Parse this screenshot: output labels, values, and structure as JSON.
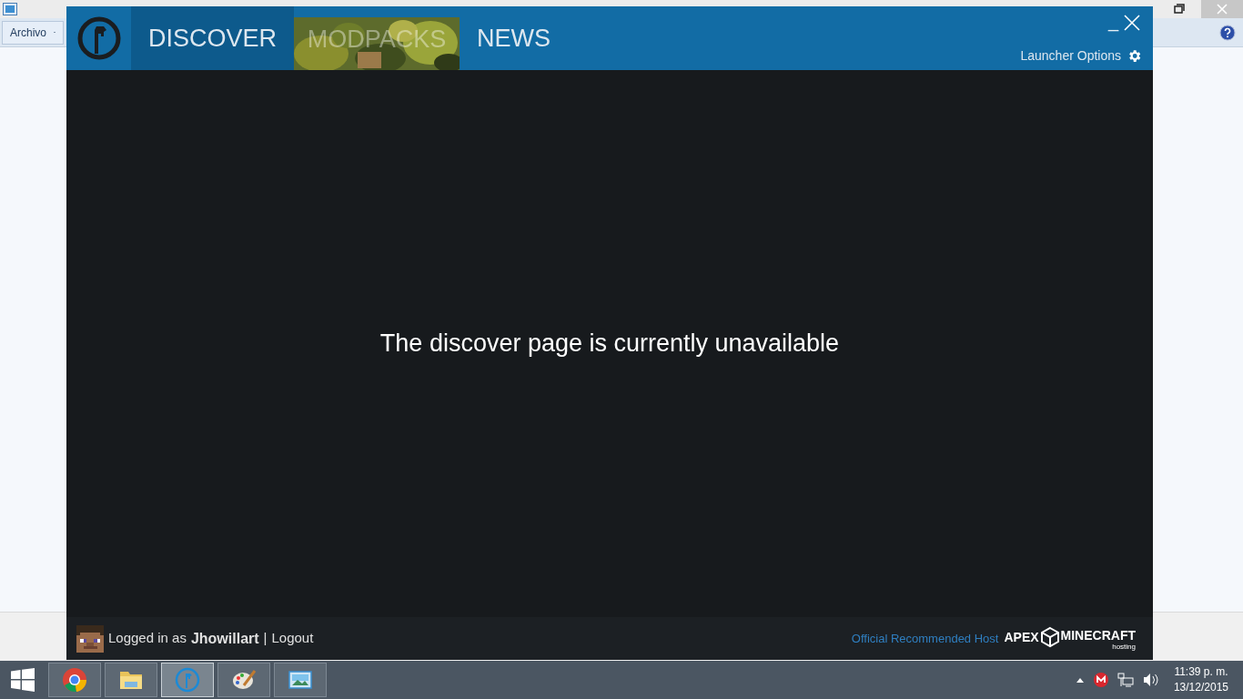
{
  "background_window": {
    "menu_button": "Archivo"
  },
  "launcher": {
    "tabs": [
      {
        "label": "DISCOVER",
        "selected": true,
        "kind": "text"
      },
      {
        "label": "MODPACKS",
        "selected": false,
        "kind": "picture"
      },
      {
        "label": "NEWS",
        "selected": false,
        "kind": "text"
      }
    ],
    "minimize": "_",
    "options_label": "Launcher Options",
    "message": "The discover page is currently unavailable",
    "footer": {
      "logged_in_prefix": "Logged in as",
      "username": "Jhowillart",
      "separator": "|",
      "logout": "Logout",
      "host_label": "Official Recommended Host",
      "host_brand_left": "APEX",
      "host_brand_right": "MINECRAFT",
      "host_brand_sub": "hosting"
    }
  },
  "taskbar": {
    "apps": [
      {
        "kind": "chrome",
        "selected": false
      },
      {
        "kind": "folder",
        "selected": false
      },
      {
        "kind": "launcher",
        "selected": true
      },
      {
        "kind": "paint",
        "selected": false
      },
      {
        "kind": "photos",
        "selected": false
      }
    ],
    "time": "11:39 p. m.",
    "date": "13/12/2015"
  }
}
